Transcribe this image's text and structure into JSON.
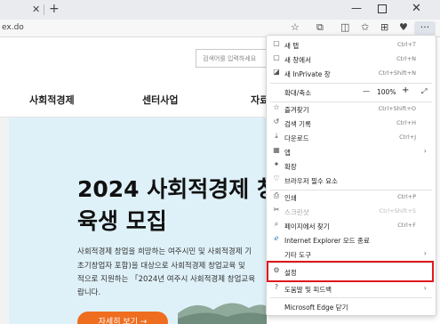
{
  "browser": {
    "tab_close": "✕",
    "new_tab": "+",
    "url": "ex.do",
    "window": {
      "minimize": "—",
      "close": "✕"
    }
  },
  "site": {
    "search_placeholder": "검색어를 입력하세요",
    "nav": [
      "사회적경제",
      "센터사업",
      "자료"
    ],
    "hero": {
      "title_line1": "2024 사회적경제 창",
      "title_line2": "육생 모집",
      "body_lines": [
        "사회적경제 창업을 희망하는 여주시민 및 사회적경제 기",
        "초기창업자 포함)을 대상으로 사회적경제 창업교육 및 ",
        "적으로 지원하는 「2024년 여주시 사회적경제 창업교육",
        "랍니다."
      ],
      "button": "자세히 보기 →"
    }
  },
  "menu": {
    "items": [
      {
        "icon": "▢",
        "icon_name": "new-tab-icon",
        "label": "새 탭",
        "shortcut": "Ctrl+T"
      },
      {
        "icon": "▢",
        "icon_name": "new-window-icon",
        "label": "새 창에서",
        "shortcut": "Ctrl+N"
      },
      {
        "icon": "◪",
        "icon_name": "inprivate-icon",
        "label": "새 InPrivate 창",
        "shortcut": "Ctrl+Shift+N"
      },
      {
        "label": "확대/축소",
        "zoom": "100%",
        "minus": "—",
        "plus": "+",
        "expand": "⤢"
      },
      {
        "icon": "☆",
        "icon_name": "favorites-icon",
        "label": "즐겨찾기",
        "shortcut": "Ctrl+Shift+O"
      },
      {
        "icon": "↺",
        "icon_name": "history-icon",
        "label": "검색 기록",
        "shortcut": "Ctrl+H"
      },
      {
        "icon": "⤓",
        "icon_name": "downloads-icon",
        "label": "다운로드",
        "shortcut": "Ctrl+J"
      },
      {
        "icon": "▦",
        "icon_name": "apps-icon",
        "label": "앱",
        "chevron": "›"
      },
      {
        "icon": "✦",
        "icon_name": "extensions-icon",
        "label": "확장"
      },
      {
        "icon": "♡",
        "icon_name": "browser-essentials-icon",
        "label": "브라우저 필수 요소"
      },
      {
        "icon": "⎙",
        "icon_name": "print-icon",
        "label": "인쇄",
        "shortcut": "Ctrl+P"
      },
      {
        "icon": "✂",
        "icon_name": "screenshot-icon",
        "label": "스크린샷",
        "shortcut": "Ctrl+Shift+S",
        "disabled": true
      },
      {
        "icon": "⌕",
        "icon_name": "find-icon",
        "label": "페이지에서 찾기",
        "shortcut": "Ctrl+F"
      },
      {
        "icon": "ℯ",
        "icon_name": "ie-mode-icon",
        "label": "Internet Explorer 모드 종료"
      },
      {
        "label": "기타 도구",
        "chevron": "›"
      },
      {
        "icon": "⚙",
        "icon_name": "settings-icon",
        "label": "설정"
      },
      {
        "icon": "?",
        "icon_name": "help-icon",
        "label": "도움말 및 피드백",
        "chevron": "›"
      },
      {
        "label": "Microsoft Edge 닫기"
      }
    ]
  },
  "colors": {
    "highlight": "#e0181f",
    "hero_bg": "#dff1f8",
    "button": "#ee6d1f"
  }
}
